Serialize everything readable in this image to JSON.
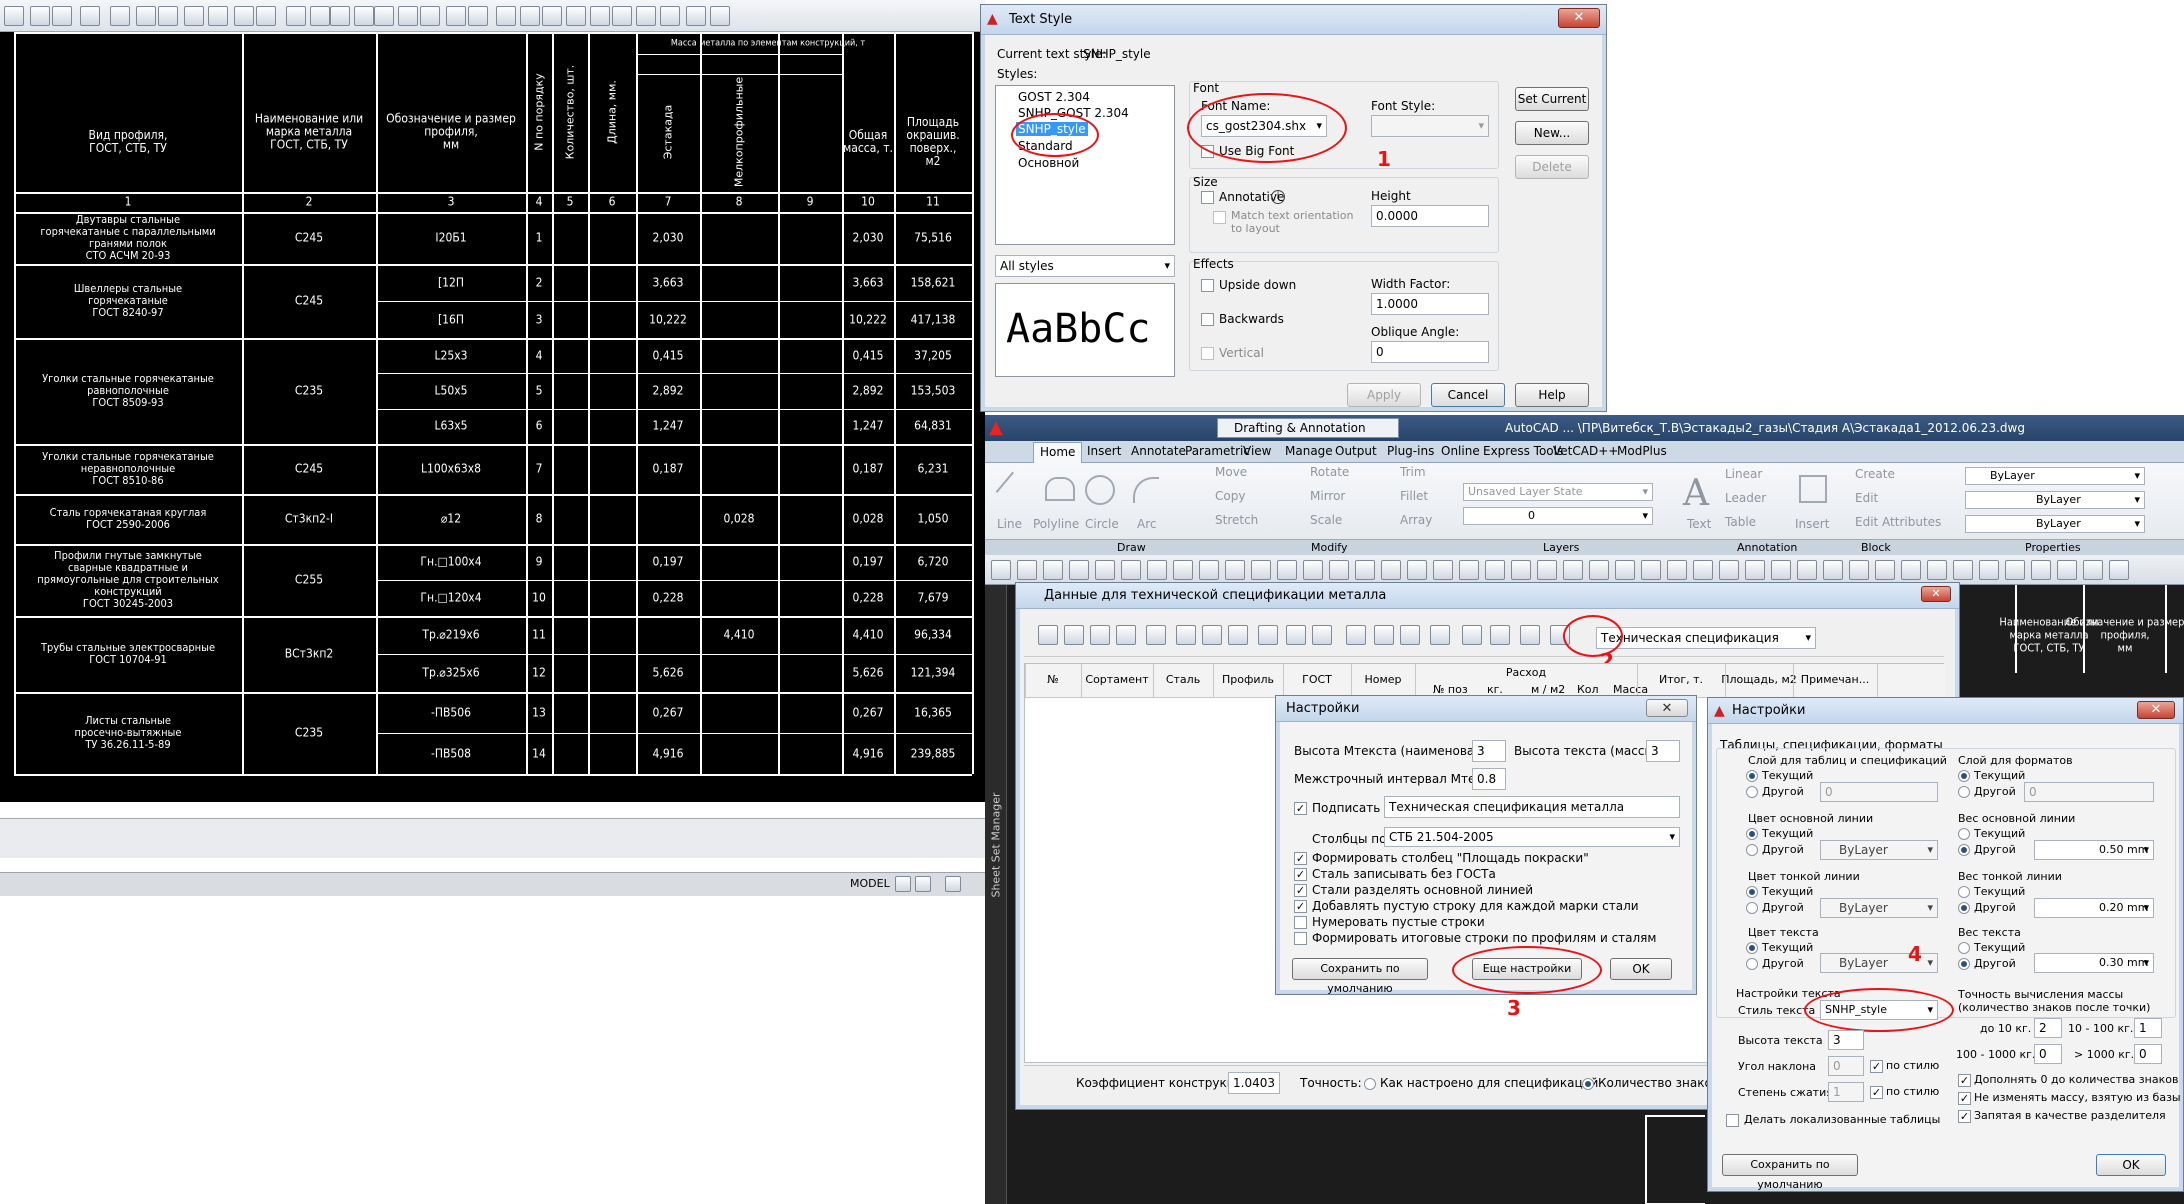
{
  "cad_left": {
    "status_model": "MODEL"
  },
  "spec": {
    "headers": {
      "c1": "Вид профиля,\nГОСТ, СТБ, ТУ",
      "c2": "Наименование или\nмарка металла\nГОСТ, СТБ, ТУ",
      "c3": "Обозначение и размер\nпрофиля,\nмм",
      "c4": "N по порядку",
      "c5": "Количество, шт.",
      "c6": "Длина, мм.",
      "group": "Масса металла по элементам конструкций, т",
      "c7": "Эстакада",
      "c8": "Мелкопрофильные",
      "c10": "Общая\nмасса, т.",
      "c11": "Площадь\nокрашив.\nповерх.,\nм2"
    },
    "colnums": [
      "1",
      "2",
      "3",
      "4",
      "5",
      "6",
      "7",
      "8",
      "9",
      "10",
      "11"
    ],
    "rows": [
      {
        "c1": "Двутавры стальные\nгорячекатаные с параллельными\nгранями полок\nСТО АСЧМ 20-93",
        "c2": "С245",
        "c3": "I20Б1",
        "c4": "1",
        "c7": "2,030",
        "c8": "",
        "c10": "2,030",
        "c11": "75,516"
      },
      {
        "c1": "Швеллеры стальные\nгорячекатаные\nГОСТ 8240-97",
        "c2": "С245",
        "c3": "[12П",
        "c4": "2",
        "c7": "3,663",
        "c8": "",
        "c10": "3,663",
        "c11": "158,621"
      },
      {
        "c3": "[16П",
        "c4": "3",
        "c7": "10,222",
        "c8": "",
        "c10": "10,222",
        "c11": "417,138"
      },
      {
        "c1": "Уголки стальные горячекатаные\nравнополочные\nГОСТ 8509-93",
        "c2": "С235",
        "c3": "L25x3",
        "c4": "4",
        "c7": "0,415",
        "c8": "",
        "c10": "0,415",
        "c11": "37,205"
      },
      {
        "c3": "L50x5",
        "c4": "5",
        "c7": "2,892",
        "c8": "",
        "c10": "2,892",
        "c11": "153,503"
      },
      {
        "c3": "L63x5",
        "c4": "6",
        "c7": "1,247",
        "c8": "",
        "c10": "1,247",
        "c11": "64,831"
      },
      {
        "c1": "Уголки стальные горячекатаные\nнеравнополочные\nГОСТ 8510-86",
        "c2": "С245",
        "c3": "L100x63x8",
        "c4": "7",
        "c7": "0,187",
        "c8": "",
        "c10": "0,187",
        "c11": "6,231"
      },
      {
        "c1": "Сталь горячекатаная круглая\nГОСТ 2590-2006",
        "c2": "Ст3кп2-I",
        "c3": "⌀12",
        "c4": "8",
        "c7": "",
        "c8": "0,028",
        "c10": "0,028",
        "c11": "1,050"
      },
      {
        "c1": "Профили гнутые замкнутые\nсварные квадратные и\nпрямоугольные для строительных\nконструкций\nГОСТ 30245-2003",
        "c2": "С255",
        "c3": "Гн.□100x4",
        "c4": "9",
        "c7": "0,197",
        "c8": "",
        "c10": "0,197",
        "c11": "6,720"
      },
      {
        "c3": "Гн.□120x4",
        "c4": "10",
        "c7": "0,228",
        "c8": "",
        "c10": "0,228",
        "c11": "7,679"
      },
      {
        "c1": "Трубы стальные электросварные\nГОСТ 10704-91",
        "c2": "ВСт3кп2",
        "c3": "Тр.⌀219x6",
        "c4": "11",
        "c7": "",
        "c8": "4,410",
        "c10": "4,410",
        "c11": "96,334"
      },
      {
        "c3": "Тр.⌀325x6",
        "c4": "12",
        "c7": "5,626",
        "c8": "",
        "c10": "5,626",
        "c11": "121,394"
      },
      {
        "c1": "Листы стальные\nпросечно-вытяжные\nТУ 36.26.11-5-89",
        "c2": "С235",
        "c3": "-ПВ506",
        "c4": "13",
        "c7": "0,267",
        "c8": "",
        "c10": "0,267",
        "c11": "16,365"
      },
      {
        "c3": "-ПВ508",
        "c4": "14",
        "c7": "4,916",
        "c8": "",
        "c10": "4,916",
        "c11": "239,885"
      }
    ]
  },
  "text_style": {
    "title": "Text Style",
    "current_label": "Current text style:",
    "current_value": "SNHP_style",
    "styles_label": "Styles:",
    "styles": [
      "GOST 2.304",
      "SNHP_GOST 2.304",
      "SNHP_style",
      "Standard",
      "Основной"
    ],
    "filter": "All styles",
    "preview": "AaBbCc",
    "font_group": "Font",
    "font_name_label": "Font Name:",
    "font_name": "cs_gost2304.shx",
    "font_style_label": "Font Style:",
    "big_font": "Use Big Font",
    "size_group": "Size",
    "annotative": "Annotative",
    "match": "Match text orientation\nto layout",
    "height_label": "Height",
    "height": "0.0000",
    "effects_group": "Effects",
    "upside": "Upside down",
    "backwards": "Backwards",
    "vertical": "Vertical",
    "width_label": "Width Factor:",
    "width": "1.0000",
    "oblique_label": "Oblique Angle:",
    "oblique": "0",
    "set_current": "Set Current",
    "new": "New...",
    "delete": "Delete",
    "apply": "Apply",
    "cancel": "Cancel",
    "help": "Help",
    "mark": "1"
  },
  "acad": {
    "workspace": "Drafting & Annotation",
    "title": "AutoCAD ... \\ПР\\Витебск_Т.В\\Эстакады2_газы\\Стадия А\\Эстакада1_2012.06.23.dwg",
    "tabs": [
      "Home",
      "Insert",
      "Annotate",
      "Parametric",
      "View",
      "Manage",
      "Output",
      "Plug-ins",
      "Online",
      "Express Tools",
      "VetCAD++",
      "ModPlus"
    ],
    "draw": {
      "line": "Line",
      "polyline": "Polyline",
      "circle": "Circle",
      "arc": "Arc"
    },
    "modify": {
      "move": "Move",
      "copy": "Copy",
      "stretch": "Stretch",
      "rotate": "Rotate",
      "mirror": "Mirror",
      "scale": "Scale",
      "trim": "Trim",
      "fillet": "Fillet",
      "array": "Array"
    },
    "layers": {
      "state": "Unsaved Layer State",
      "layer": "0"
    },
    "annotation": {
      "text": "Text",
      "linear": "Linear",
      "leader": "Leader",
      "table": "Table"
    },
    "block": {
      "insert": "Insert",
      "create": "Create",
      "edit": "Edit",
      "edit_attr": "Edit Attributes"
    },
    "props": {
      "bylayer1": "ByLayer",
      "bylayer2": "ByLayer",
      "bylayer3": "ByLayer"
    },
    "panels": [
      "Draw",
      "Modify",
      "Layers",
      "Annotation",
      "Block",
      "Properties"
    ],
    "sheet_set": "Sheet Set Manager"
  },
  "metal": {
    "title": "Данные для технической спецификации металла",
    "combo": "Техническая спецификация",
    "mark": "2",
    "cols": [
      "№",
      "Сортамент",
      "Сталь",
      "Профиль",
      "ГОСТ",
      "Номер",
      "Расход",
      "Итог, т.",
      "Площадь, м2",
      "Примечан..."
    ],
    "subcols": [
      "№ поз",
      "кг.",
      "м / м2",
      "Кол",
      "Масса"
    ],
    "coef_label": "Коэффициент конструкции",
    "coef": "1.0403",
    "prec_label": "Точность:",
    "prec_opt1": "Как настроено для спецификаций",
    "prec_opt2": "Количество знаков"
  },
  "settings1": {
    "title": "Настройки",
    "h1_label": "Высота Мтекста (наименования)",
    "h1": "3",
    "h2_label": "Высота текста (массы)",
    "h2": "3",
    "line_label": "Межстрочный интервал  Мтекста",
    "line": "0.8",
    "sign_label": "Подписать",
    "sign": "Техническая спецификация металла",
    "cols_label": "Столбцы по",
    "cols": "СТБ 21.504-2005",
    "checks": [
      "Формировать столбец \"Площадь покраски\"",
      "Сталь записывать без ГОСТа",
      "Стали разделять основной линией",
      "Добавлять пустую строку для каждой марки стали",
      "Нумеровать пустые строки",
      "Формировать итоговые строки по профилям и сталям"
    ],
    "save": "Сохранить по умолчанию",
    "more": "Еще настройки",
    "ok": "OK",
    "mark": "3"
  },
  "settings2": {
    "title": "Настройки",
    "section": "Таблицы, спецификации, форматы",
    "layer_tbl": "Слой для таблиц и спецификаций",
    "layer_fmt": "Слой для форматов",
    "current": "Текущий",
    "other": "Другой",
    "zero": "0",
    "main_color": "Цвет основной линии",
    "thin_color": "Цвет тонкой линии",
    "text_color": "Цвет текста",
    "bylayer": "ByLayer",
    "main_w": "Вес основной линии",
    "thin_w": "Вес тонкой линии",
    "text_w": "Вес текста",
    "w050": "0.50 mm",
    "w020": "0.20 mm",
    "w030": "0.30 mm",
    "text_set": "Настройки текста",
    "style_label": "Стиль текста",
    "style": "SNHP_style",
    "height_label": "Высота текста",
    "height": "3",
    "angle_label": "Угол наклона",
    "angle": "0",
    "compress_label": "Степень сжатия",
    "compress": "1",
    "by_style": "по стилю",
    "prec_title": "Точность вычисления массы\n(количество знаков после точки)",
    "to10": "до 10 кг.",
    "to10v": "2",
    "to100": "10 - 100 кг.",
    "to100v": "1",
    "to1000": "100 - 1000 кг.",
    "to1000v": "0",
    "gt1000": "> 1000 кг.",
    "gt1000v": "0",
    "c1": "Дополнять 0 до количества знаков",
    "c2": "Не изменять массу, взятую из базы",
    "c3": "Запятая в качестве разделителя",
    "localized": "Делать локализованные таблицы",
    "save": "Сохранить по умолчанию",
    "ok": "OK",
    "mark": "4"
  },
  "bg_tbl": {
    "h1": "Вид профиля,\nГОСТ, СТБ, ТУ",
    "h2": "Наименование или\nмарка металла\nГОСТ, СТБ, ТУ",
    "h3": "Обозначение и размер\nпрофиля,\nмм"
  }
}
